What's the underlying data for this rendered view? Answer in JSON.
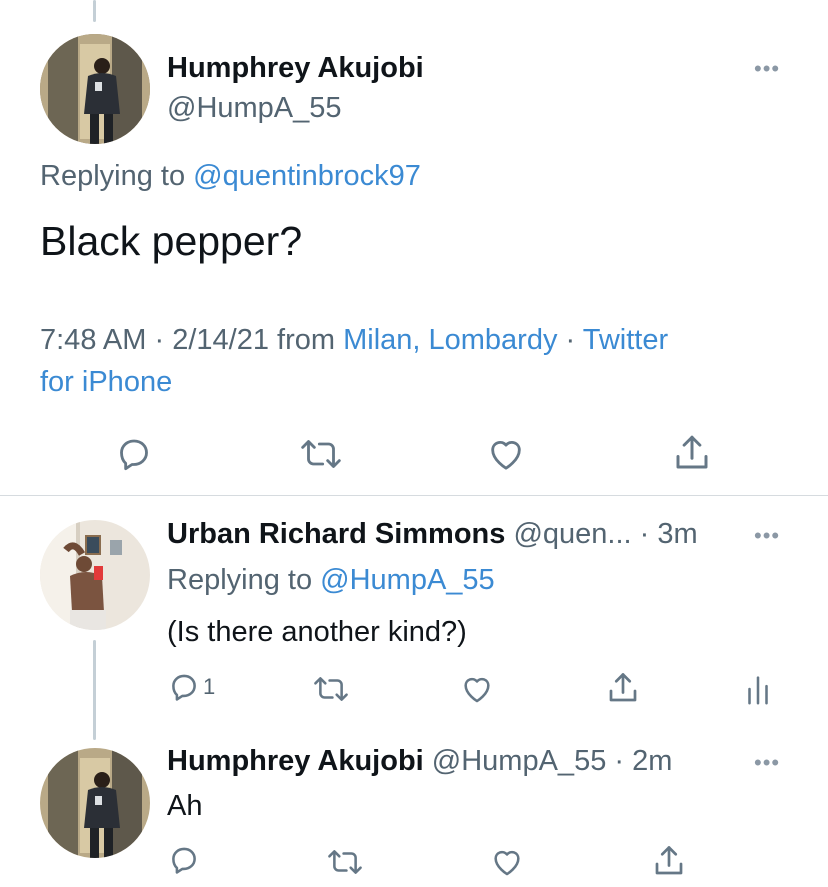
{
  "main_tweet": {
    "author_name": "Humphrey Akujobi",
    "author_handle": "@HumpA_55",
    "replying_prefix": "Replying to",
    "replying_to": "@quentinbrock97",
    "text": "Black pepper?",
    "time": "7:48 AM",
    "date": "2/14/21",
    "from_word": "from",
    "location": "Milan, Lombardy",
    "source_line1": "Twitter",
    "source_line2": "for iPhone",
    "more_icon": "more-horizontal-icon"
  },
  "reply_1": {
    "author_name": "Urban Richard Simmons",
    "author_handle": "@quen...",
    "age": "3m",
    "replying_prefix": "Replying to",
    "replying_to": "@HumpA_55",
    "text": "(Is there another kind?)",
    "reply_count": "1"
  },
  "reply_2": {
    "author_name": "Humphrey Akujobi",
    "author_handle": "@HumpA_55",
    "age": "2m",
    "text": "Ah"
  },
  "colors": {
    "link": "#3b8ad3",
    "text": "#0f1419",
    "muted": "#536471",
    "icon": "#657786"
  }
}
